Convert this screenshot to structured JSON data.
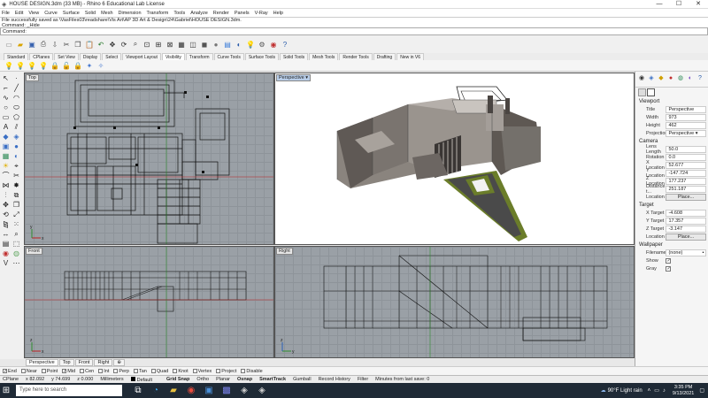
{
  "titlebar": {
    "title": "HOUSE DESIGN.3dm (33 MB) - Rhino 6 Educational Lab License",
    "minimize": "—",
    "maximize": "☐",
    "close": "✕"
  },
  "menu": [
    "File",
    "Edit",
    "View",
    "Curve",
    "Surface",
    "Solid",
    "Mesh",
    "Dimension",
    "Transform",
    "Tools",
    "Analyze",
    "Render",
    "Panels",
    "V-Ray",
    "Help"
  ],
  "command_history": [
    "File successfully saved as \\VasFiles03\\readshare\\Vis Art\\AP 3D Art & Design\\24\\Gabriel\\HOUSE DESIGN.3dm.",
    "Command: _Hide"
  ],
  "command_prompt": "Command:",
  "toolbar_tabs": [
    "Standard",
    "CPlanes",
    "Set View",
    "Display",
    "Select",
    "Viewport Layout",
    "Visibility",
    "Transform",
    "Curve Tools",
    "Surface Tools",
    "Solid Tools",
    "Mesh Tools",
    "Render Tools",
    "Drafting",
    "New in V6"
  ],
  "active_toolbar_tab": "Visibility",
  "viewports": {
    "top": "Top",
    "perspective": "Perspective",
    "front": "Front",
    "right": "Right",
    "dropdown": "▾"
  },
  "view_tabs": [
    "Perspective",
    "Top",
    "Front",
    "Right",
    "⊕"
  ],
  "properties_panel": {
    "viewport_header": "Viewport",
    "viewport_rows": [
      {
        "k": "Title",
        "v": "Perspective"
      },
      {
        "k": "Width",
        "v": "973"
      },
      {
        "k": "Height",
        "v": "462"
      },
      {
        "k": "Projection",
        "v": "Perspective"
      }
    ],
    "camera_header": "Camera",
    "camera_rows": [
      {
        "k": "Lens Length",
        "v": "50.0"
      },
      {
        "k": "Rotation",
        "v": "0.0"
      },
      {
        "k": "X Location",
        "v": "52.677"
      },
      {
        "k": "Y Location",
        "v": "-147.724"
      },
      {
        "k": "Z Location",
        "v": "177.237"
      },
      {
        "k": "Distance t...",
        "v": "251.187"
      }
    ],
    "camera_location_label": "Location",
    "camera_location_button": "Place...",
    "target_header": "Target",
    "target_rows": [
      {
        "k": "X Target",
        "v": "-4.608"
      },
      {
        "k": "Y Target",
        "v": "17.357"
      },
      {
        "k": "Z Target",
        "v": "-3.147"
      }
    ],
    "target_location_label": "Location",
    "target_location_button": "Place...",
    "wallpaper_header": "Wallpaper",
    "wallpaper_filename_label": "Filename",
    "wallpaper_filename_value": "(none)",
    "wallpaper_show_label": "Show",
    "wallpaper_gray_label": "Gray"
  },
  "osnaps": [
    {
      "label": "End",
      "checked": true
    },
    {
      "label": "Near",
      "checked": false
    },
    {
      "label": "Point",
      "checked": false
    },
    {
      "label": "Mid",
      "checked": true
    },
    {
      "label": "Cen",
      "checked": false
    },
    {
      "label": "Int",
      "checked": false
    },
    {
      "label": "Perp",
      "checked": false
    },
    {
      "label": "Tan",
      "checked": false
    },
    {
      "label": "Quad",
      "checked": false
    },
    {
      "label": "Knot",
      "checked": false
    },
    {
      "label": "Vertex",
      "checked": false
    },
    {
      "label": "Project",
      "checked": false
    },
    {
      "label": "Disable",
      "checked": false
    }
  ],
  "statusbar": {
    "cplane": "CPlane",
    "x": "x 82.092",
    "y": "y 74.699",
    "z": "z 0.000",
    "units": "Millimeters",
    "layer": "Default",
    "grid_snap": "Grid Snap",
    "ortho": "Ortho",
    "planar": "Planar",
    "osnap": "Osnap",
    "smarttrack": "SmartTrack",
    "gumball": "Gumball",
    "record_history": "Record History",
    "filter": "Filter",
    "autosave": "Minutes from last save: 0"
  },
  "taskbar": {
    "search_placeholder": "Type here to search",
    "weather": "90°F  Light rain",
    "time": "3:35 PM",
    "date": "9/13/2021"
  },
  "colors": {
    "viewport_bg": "#9aa0a6",
    "active_label": "#b8cde8",
    "taskbar": "#1f2a36"
  }
}
